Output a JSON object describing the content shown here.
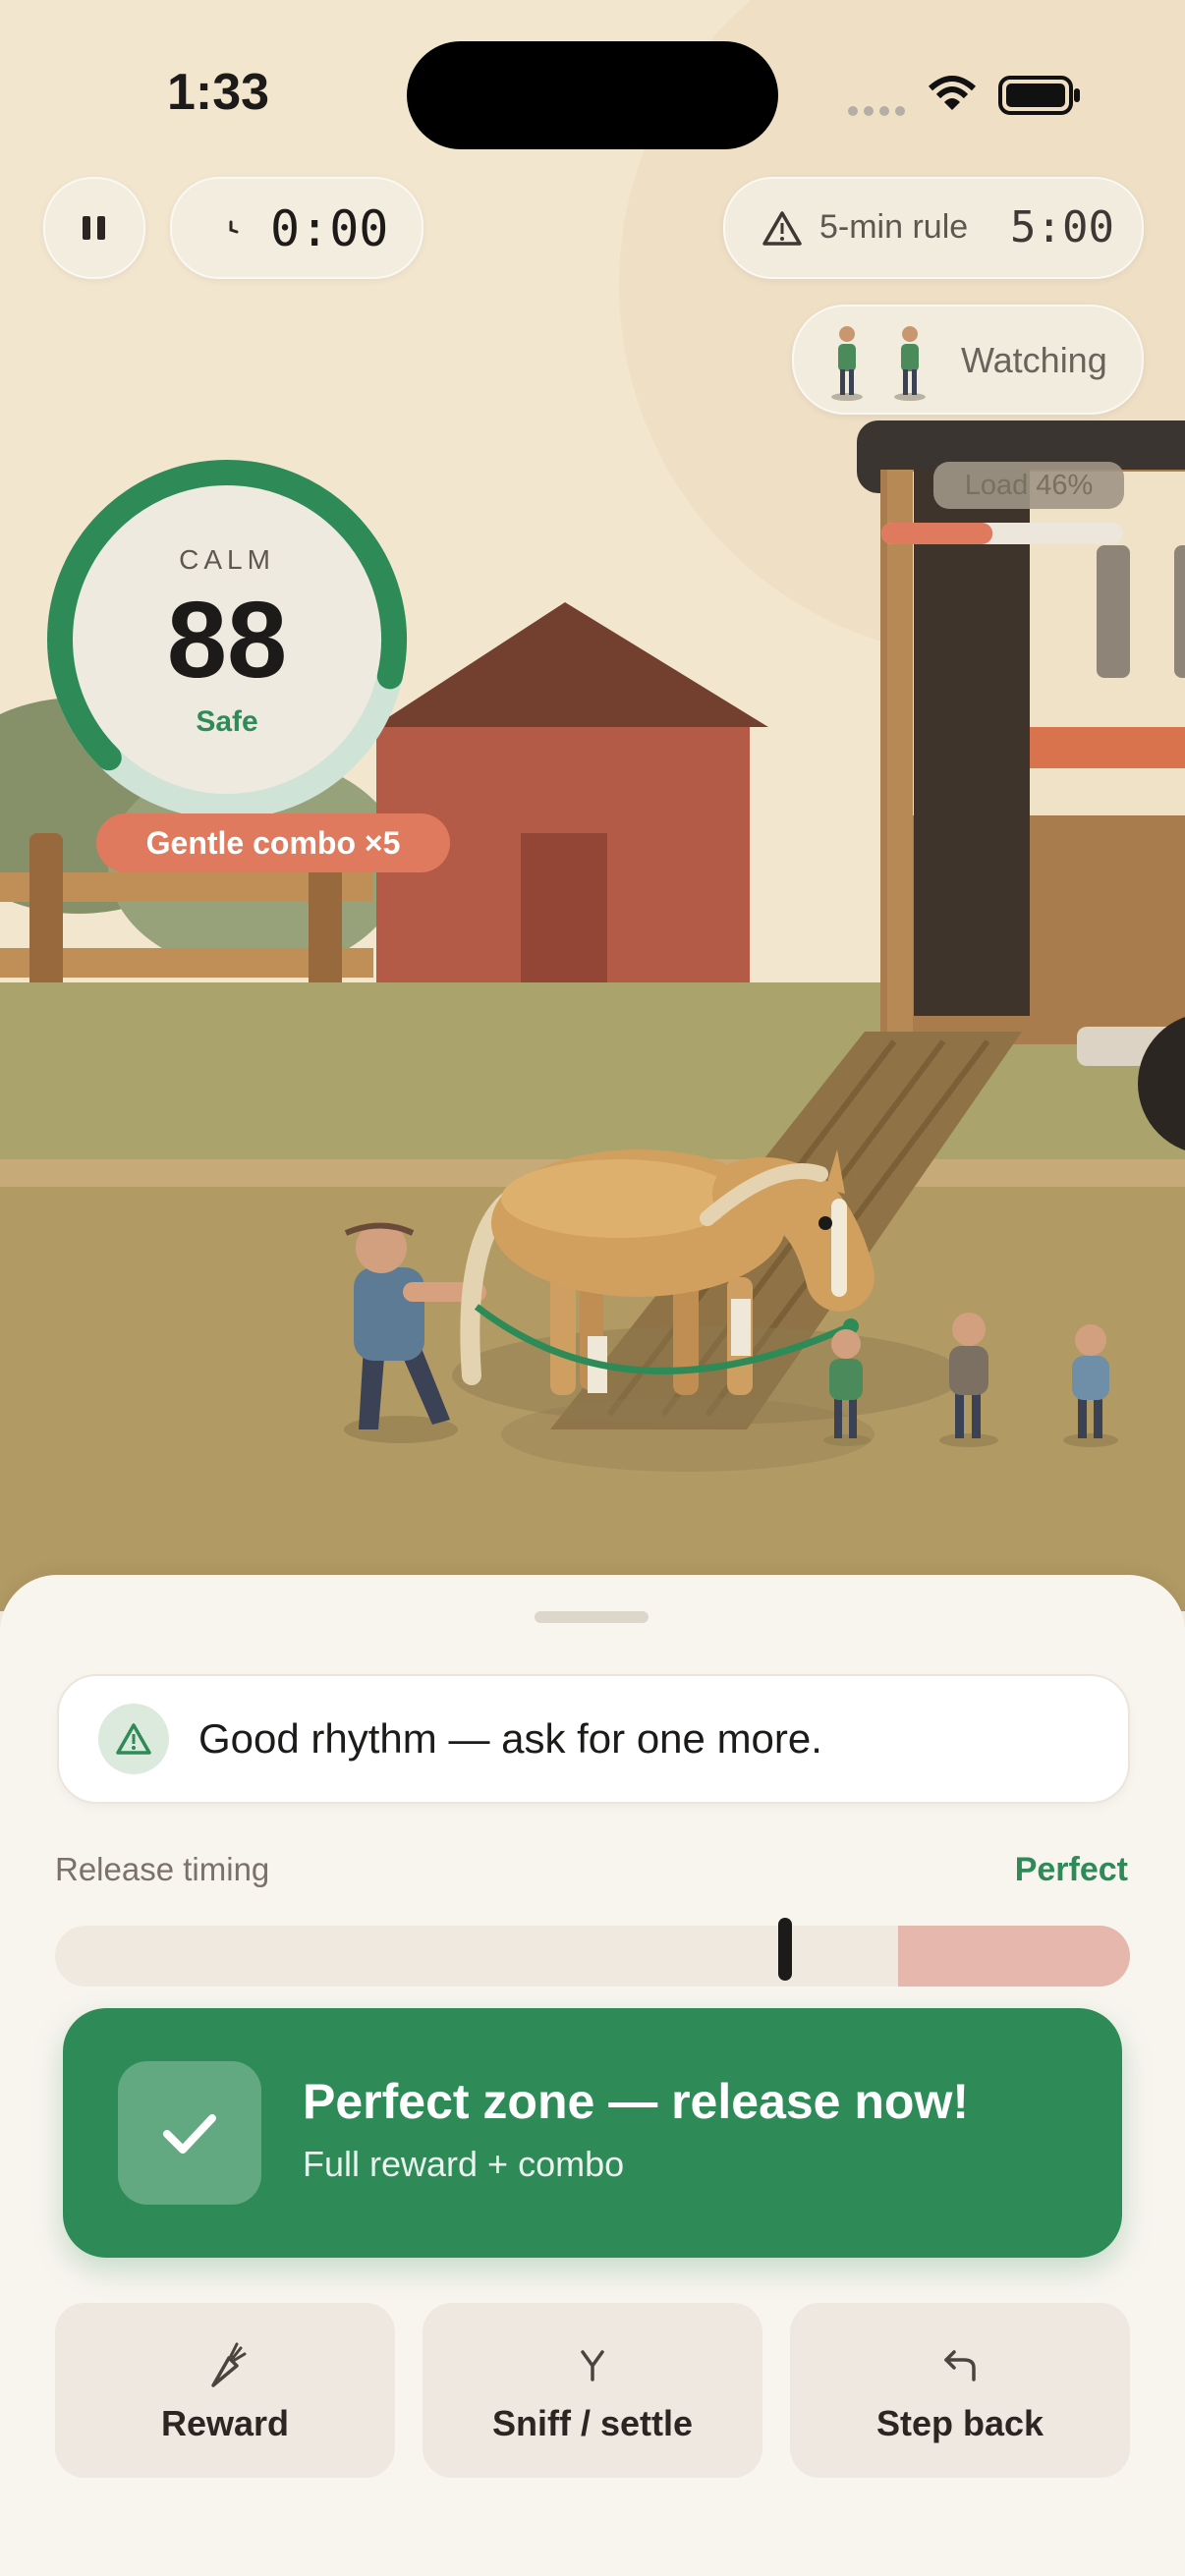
{
  "status_bar": {
    "time": "1:33"
  },
  "hud": {
    "elapsed_timer": "0:00",
    "rule_label": "5-min rule",
    "rule_timer": "5:00",
    "watching_label": "Watching"
  },
  "trailer": {
    "load_label": "Load 46%",
    "load_fraction": 0.46
  },
  "calm_gauge": {
    "label": "CALM",
    "value": "88",
    "status": "Safe",
    "fraction": 0.88
  },
  "combo_badge": "Gentle combo ×5",
  "bottom_sheet": {
    "hint": "Good rhythm — ask for one more.",
    "release_timing_label": "Release timing",
    "release_timing_status": "Perfect",
    "cta": {
      "title": "Perfect zone — release now!",
      "subtitle": "Full reward + combo"
    },
    "actions": [
      {
        "label": "Reward",
        "icon": "carrot-icon"
      },
      {
        "label": "Sniff / settle",
        "icon": "sniff-icon"
      },
      {
        "label": "Step back",
        "icon": "step-back-arrow-icon"
      }
    ]
  },
  "colors": {
    "accent_green": "#2e8b57",
    "warning_coral": "#e07a5f",
    "barn_red": "#b45b47",
    "background": "#f5efe2"
  }
}
